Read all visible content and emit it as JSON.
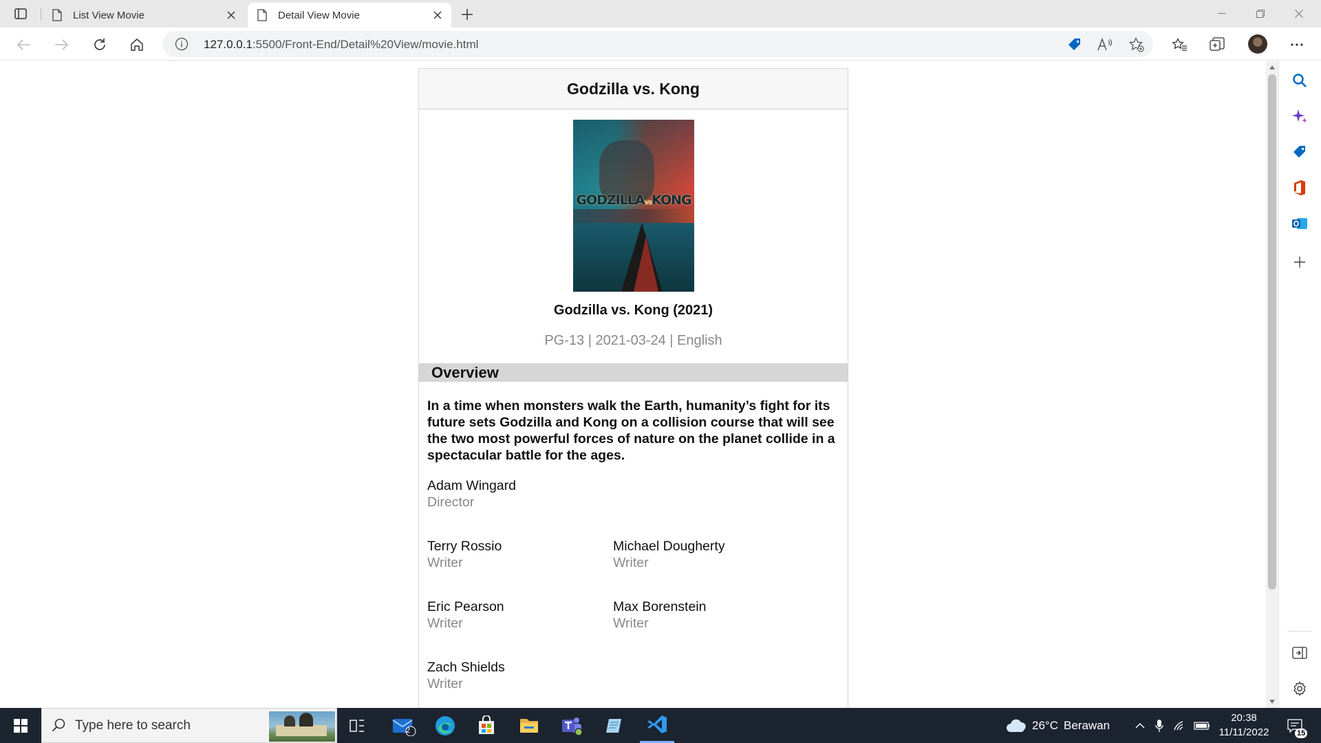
{
  "browser": {
    "tabs": [
      {
        "label": "List View Movie",
        "active": false
      },
      {
        "label": "Detail View Movie",
        "active": true
      }
    ],
    "url_host": "127.0.0.1",
    "url_path": ":5500/Front-End/Detail%20View/movie.html"
  },
  "page": {
    "header_title": "Godzilla vs. Kong",
    "poster": {
      "logo_left": "GODZILLA",
      "logo_vs": "vs",
      "logo_right": "KONG"
    },
    "movie_title": "Godzilla vs. Kong (2021)",
    "meta": "PG-13 | 2021-03-24 | English",
    "overview_heading": "Overview",
    "overview_text": "In a time when monsters walk the Earth, humanity’s fight for its future sets Godzilla and Kong on a collision course that will see the two most powerful forces of nature on the planet collide in a spectacular battle for the ages.",
    "crew": [
      {
        "name": "Adam Wingard",
        "job": "Director"
      },
      {
        "name": "Terry Rossio",
        "job": "Writer"
      },
      {
        "name": "Michael Dougherty",
        "job": "Writer"
      },
      {
        "name": "Eric Pearson",
        "job": "Writer"
      },
      {
        "name": "Max Borenstein",
        "job": "Writer"
      },
      {
        "name": "Zach Shields",
        "job": "Writer"
      }
    ]
  },
  "taskbar": {
    "search_placeholder": "Type here to search",
    "mail_badge": "2",
    "weather_temp": "26°C",
    "weather_desc": "Berawan",
    "time": "20:38",
    "date": "11/11/2022",
    "notification_count": "15"
  },
  "colors": {
    "accent_blue": "#0067c0",
    "vscode_blue": "#2f9bf0",
    "meta_gray": "#888888",
    "section_bar": "#d6d6d6"
  }
}
